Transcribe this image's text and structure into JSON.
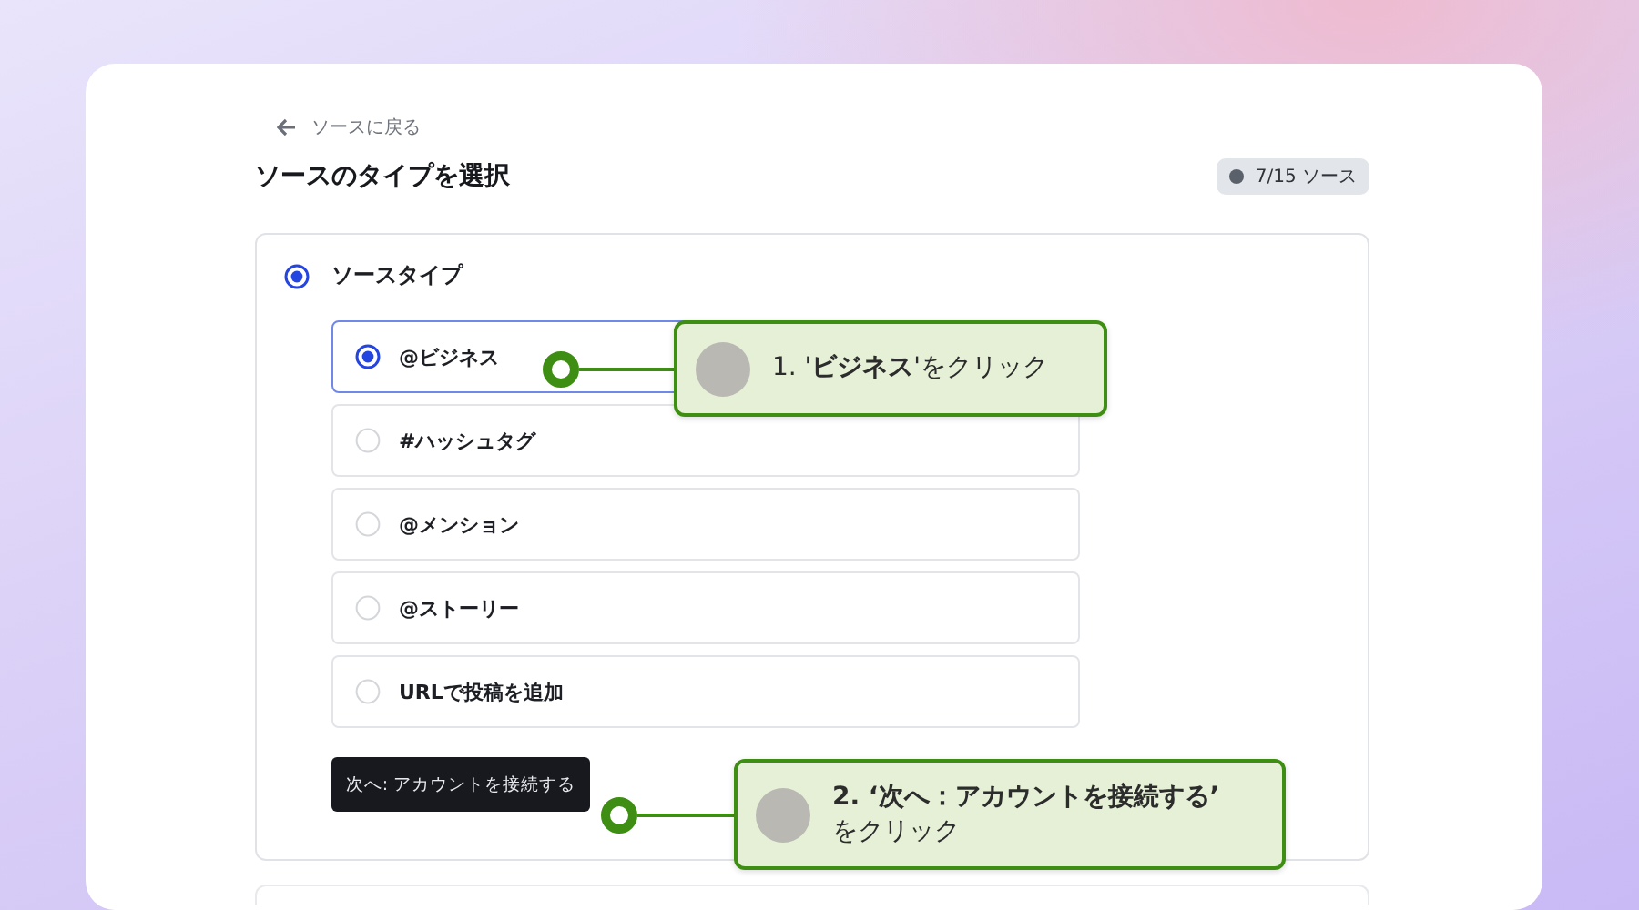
{
  "back_link": "ソースに戻る",
  "title": "ソースのタイプを選択",
  "badge": "7/15 ソース",
  "section": {
    "label": "ソースタイプ",
    "selected": true
  },
  "options": [
    {
      "label": "@ビジネス",
      "selected": true
    },
    {
      "label": "#ハッシュタグ",
      "selected": false
    },
    {
      "label": "@メンション",
      "selected": false
    },
    {
      "label": "@ストーリー",
      "selected": false
    },
    {
      "label": "URLで投稿を追加",
      "selected": false
    }
  ],
  "next_button": "次へ: アカウントを接続する",
  "callouts": [
    {
      "lines": [
        "1. '**ビジネス**'をクリック"
      ]
    },
    {
      "lines": [
        "**2. ‘次へ：アカウントを接続する’**",
        "をクリック"
      ]
    }
  ]
}
